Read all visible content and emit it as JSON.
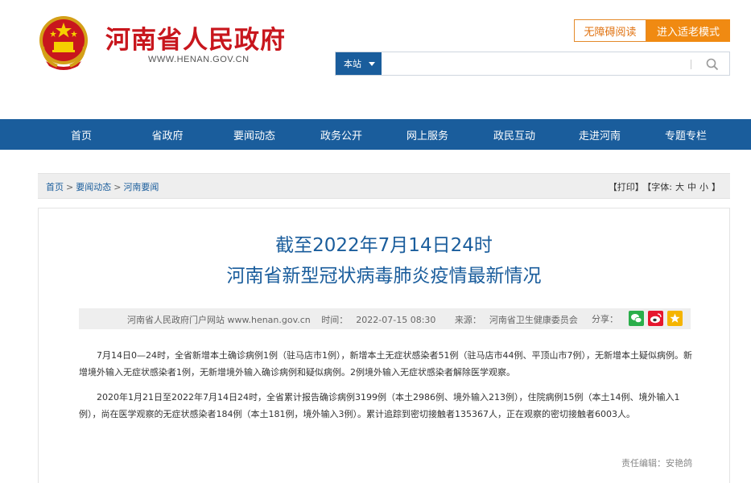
{
  "header": {
    "site_title": "河南省人民政府",
    "site_url": "WWW.HENAN.GOV.CN",
    "accessibility_label": "无障碍阅读",
    "elder_mode_label": "进入适老模式",
    "search": {
      "scope_label": "本站",
      "placeholder": "",
      "icon": "search-icon"
    }
  },
  "nav": {
    "items": [
      {
        "label": "首页"
      },
      {
        "label": "省政府"
      },
      {
        "label": "要闻动态"
      },
      {
        "label": "政务公开"
      },
      {
        "label": "网上服务"
      },
      {
        "label": "政民互动"
      },
      {
        "label": "走进河南"
      },
      {
        "label": "专题专栏"
      }
    ]
  },
  "breadcrumb": {
    "items": [
      "首页",
      "要闻动态",
      "河南要闻"
    ],
    "separator": ">"
  },
  "tools": {
    "print": "【打印】",
    "font_label": "【字体:",
    "font_large": "大",
    "font_medium": "中",
    "font_small": "小",
    "font_close": "】"
  },
  "article": {
    "title_line1": "截至2022年7月14日24时",
    "title_line2": "河南省新型冠状病毒肺炎疫情最新情况",
    "meta": {
      "site": "河南省人民政府门户网站 www.henan.gov.cn",
      "time_label": "时间：",
      "time": "2022-07-15 08:30",
      "source_label": "来源：",
      "source": "河南省卫生健康委员会",
      "share_label": "分享："
    },
    "paragraphs": [
      "7月14日0—24时，全省新增本土确诊病例1例（驻马店市1例），新增本土无症状感染者51例（驻马店市44例、平顶山市7例），无新增本土疑似病例。新增境外输入无症状感染者1例，无新增境外输入确诊病例和疑似病例。2例境外输入无症状感染者解除医学观察。",
      "2020年1月21日至2022年7月14日24时，全省累计报告确诊病例3199例（本土2986例、境外输入213例），住院病例15例（本土14例、境外输入1例），尚在医学观察的无症状感染者184例（本土181例，境外输入3例）。累计追踪到密切接触者135367人，正在观察的密切接触者6003人。"
    ],
    "editor": "责任编辑：安艳鸽"
  },
  "colors": {
    "brand_red": "#c8161d",
    "nav_blue": "#1a5d9c",
    "accent_orange": "#f08a12",
    "wechat_green": "#2aae4a",
    "weibo_red": "#e6162d",
    "favorite_yellow": "#f5b400"
  }
}
